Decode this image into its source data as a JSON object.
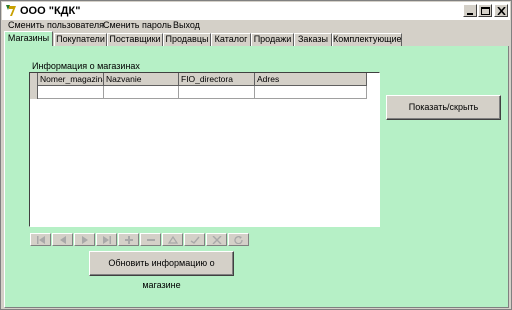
{
  "window": {
    "title": "ООО \"КДК\"",
    "controls": [
      "minimize-icon",
      "maximize-icon",
      "close-icon"
    ]
  },
  "menu": {
    "items": [
      "Сменить пользователя",
      "Сменить пароль",
      "Выход"
    ]
  },
  "tabs": {
    "items": [
      "Магазины",
      "Покупатели",
      "Поставщики",
      "Продавцы",
      "Каталог",
      "Продажи",
      "Заказы",
      "Комплектующие"
    ],
    "active": "Магазины"
  },
  "stores": {
    "group_label": "Информация о магазинах",
    "columns": [
      "Nomer_magazina",
      "Nazvanie",
      "FIO_directora",
      "Adres"
    ],
    "rows": [
      [
        "",
        "",
        "",
        ""
      ]
    ]
  },
  "navigator": {
    "buttons": [
      "first-icon",
      "prior-icon",
      "next-icon",
      "last-icon",
      "insert-icon",
      "delete-icon",
      "edit-icon",
      "post-icon",
      "cancel-icon",
      "refresh-icon"
    ]
  },
  "actions": {
    "toggle_label": "Показать/скрыть",
    "refresh_label": "Обновить информацию о магазине"
  },
  "colors": {
    "panel": "#b6f0c6",
    "chrome": "#d4d0c8",
    "disabled_glyph": "#a8a8a8"
  }
}
